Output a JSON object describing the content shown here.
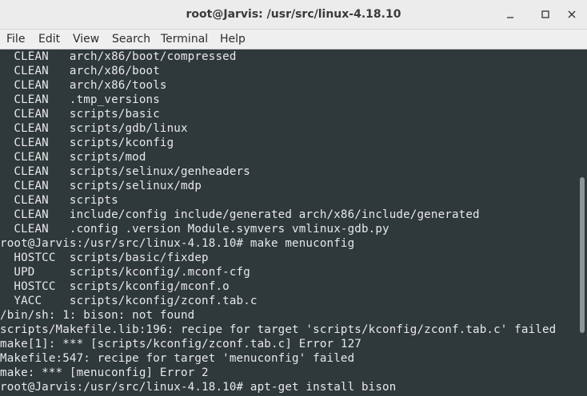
{
  "window": {
    "title": "root@Jarvis: /usr/src/linux-4.18.10",
    "minimize_icon": "minimize-icon",
    "maximize_icon": "maximize-icon",
    "close_icon": "close-icon"
  },
  "menubar": {
    "items": [
      "File",
      "Edit",
      "View",
      "Search",
      "Terminal",
      "Help"
    ]
  },
  "terminal": {
    "lines": [
      "  CLEAN   arch/x86/boot/compressed",
      "  CLEAN   arch/x86/boot",
      "  CLEAN   arch/x86/tools",
      "  CLEAN   .tmp_versions",
      "  CLEAN   scripts/basic",
      "  CLEAN   scripts/gdb/linux",
      "  CLEAN   scripts/kconfig",
      "  CLEAN   scripts/mod",
      "  CLEAN   scripts/selinux/genheaders",
      "  CLEAN   scripts/selinux/mdp",
      "  CLEAN   scripts",
      "  CLEAN   include/config include/generated arch/x86/include/generated",
      "  CLEAN   .config .version Module.symvers vmlinux-gdb.py",
      "root@Jarvis:/usr/src/linux-4.18.10# make menuconfig",
      "  HOSTCC  scripts/basic/fixdep",
      "  UPD     scripts/kconfig/.mconf-cfg",
      "  HOSTCC  scripts/kconfig/mconf.o",
      "  YACC    scripts/kconfig/zconf.tab.c",
      "/bin/sh: 1: bison: not found",
      "scripts/Makefile.lib:196: recipe for target 'scripts/kconfig/zconf.tab.c' failed",
      "make[1]: *** [scripts/kconfig/zconf.tab.c] Error 127",
      "Makefile:547: recipe for target 'menuconfig' failed",
      "make: *** [menuconfig] Error 2",
      "root@Jarvis:/usr/src/linux-4.18.10# apt-get install bison"
    ]
  },
  "colors": {
    "terminal_bg": "#2f383b",
    "terminal_fg": "#e9e9e9",
    "titlebar_bg": "#ececec",
    "menubar_bg": "#efefef"
  }
}
